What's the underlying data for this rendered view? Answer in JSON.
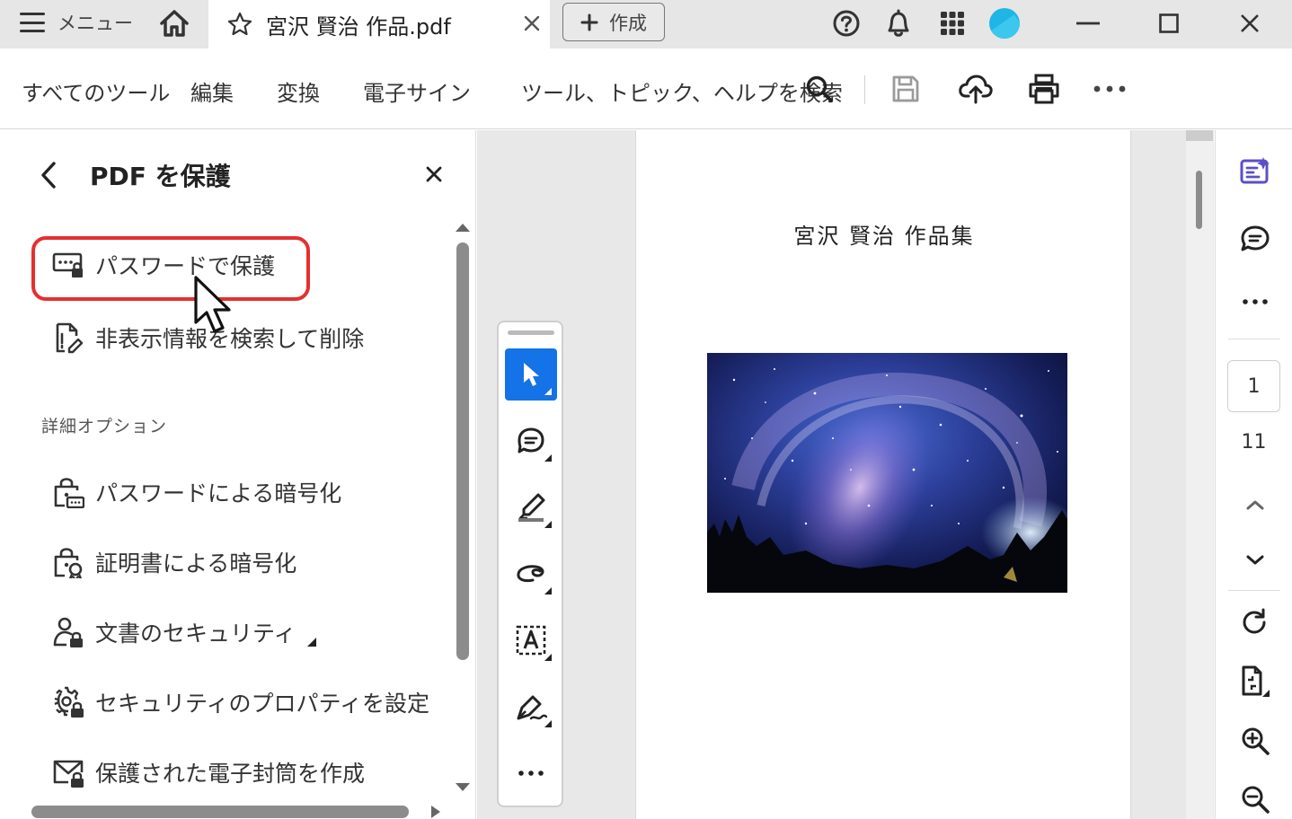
{
  "titlebar": {
    "menu_label": "メニュー",
    "tab_title": "宮沢 賢治 作品.pdf",
    "create_label": "作成"
  },
  "toolbar": {
    "all_tools": "すべてのツール",
    "edit": "編集",
    "convert": "変換",
    "esign": "電子サイン",
    "search_label": "ツール、トピック、ヘルプを検索"
  },
  "panel": {
    "title": "PDF を保護",
    "items": [
      {
        "label": "パスワードで保護",
        "icon": "password-protect-icon"
      },
      {
        "label": "非表示情報を検索して削除",
        "icon": "redact-search-icon"
      }
    ],
    "section_label": "詳細オプション",
    "advanced": [
      {
        "label": "パスワードによる暗号化",
        "icon": "lock-password-icon"
      },
      {
        "label": "証明書による暗号化",
        "icon": "lock-certificate-icon"
      },
      {
        "label": "文書のセキュリティ",
        "icon": "user-lock-icon"
      },
      {
        "label": "セキュリティのプロパティを設定",
        "icon": "gear-lock-icon"
      },
      {
        "label": "保護された電子封筒を作成",
        "icon": "envelope-lock-icon"
      }
    ]
  },
  "document": {
    "title": "宮沢  賢治  作品集",
    "image": "starry-night-sky-image"
  },
  "rail": {
    "current_page": "1",
    "total_pages": "11"
  },
  "colors": {
    "accent": "#1473e6",
    "highlight": "#e53030",
    "rail_accent": "#5b4fc7"
  }
}
